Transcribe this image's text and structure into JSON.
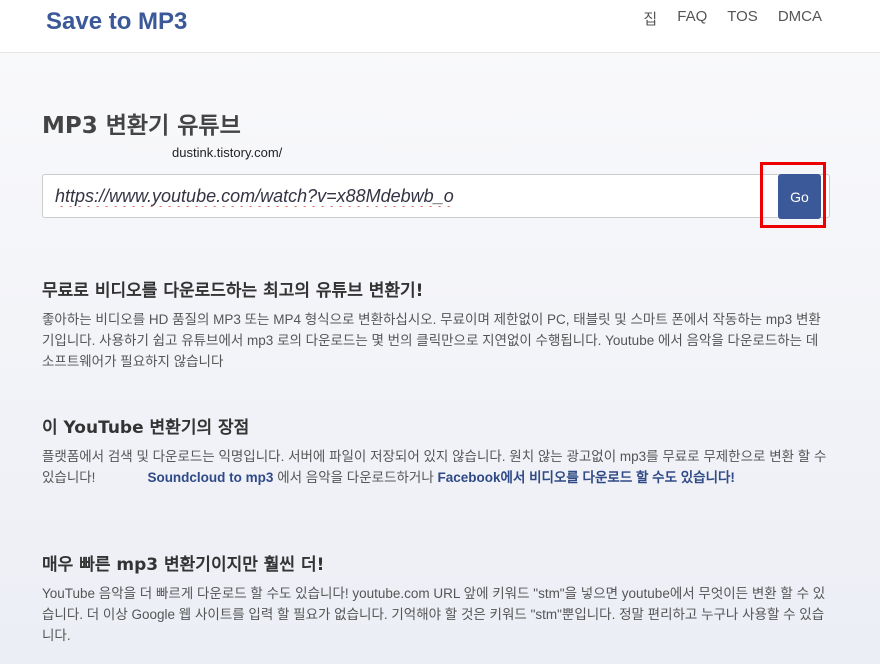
{
  "header": {
    "brand": "Save to MP3",
    "nav": [
      "집",
      "FAQ",
      "TOS",
      "DMCA"
    ]
  },
  "main": {
    "title": "MP3 변환기 유튜브",
    "watermark": "dustink.tistory.com/",
    "search": {
      "value": "https://www.youtube.com/watch?v=x88Mdebwb_o",
      "button_label": "Go"
    }
  },
  "sections": [
    {
      "heading": "무료로 비디오를 다운로드하는 최고의 유튜브 변환기!",
      "text": "좋아하는 비디오를 HD 품질의 MP3 또는 MP4 형식으로 변환하십시오. 무료이며 제한없이 PC, 태블릿 및 스마트 폰에서 작동하는 mp3 변환기입니다. 사용하기 쉽고 유튜브에서 mp3 로의 다운로드는 몇 번의 클릭만으로 지연없이 수행됩니다. Youtube 에서 음악을 다운로드하는 데 소프트웨어가 필요하지 않습니다"
    },
    {
      "heading": "이 YouTube 변환기의 장점",
      "text_before": "플랫폼에서 검색 및 다운로드는 익명입니다. 서버에 파일이 저장되어 있지 않습니다. 원치 않는 광고없이 mp3를 무료로 무제한으로 변환 할 수 있습니다!",
      "link1": "Soundcloud to mp3",
      "text_middle": "에서 음악을 다운로드하거나",
      "link2": "Facebook에서 비디오를 다운로드 할 수도 있습니다!"
    },
    {
      "heading": "매우 빠른 mp3 변환기이지만 훨씬 더!",
      "text": "YouTube 음악을 더 빠르게 다운로드 할 수도 있습니다! youtube.com URL 앞에 키워드 \"stm\"을 넣으면 youtube에서 무엇이든 변환 할 수 있습니다. 더 이상 Google 웹 사이트를 입력 할 필요가 없습니다. 기억해야 할 것은 키워드 \"stm\"뿐입니다. 정말 편리하고 누구나 사용할 수 있습니다."
    }
  ]
}
